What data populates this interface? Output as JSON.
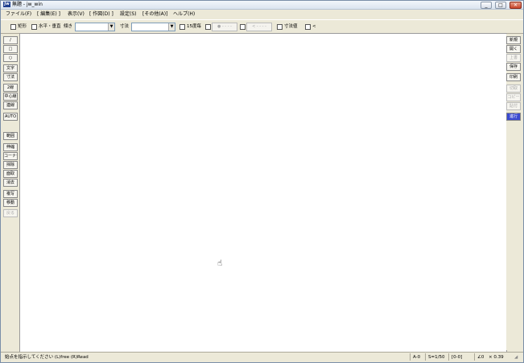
{
  "titlebar": {
    "title": "無題 - jw_win",
    "icon_text": "Jw"
  },
  "menus": [
    "ファイル(F)",
    "[ 編集(E) ]",
    "表示(V)",
    "[ 作図(D) ]",
    "設定(S)",
    "[その他(A)]",
    "ヘルプ(H)"
  ],
  "toolbar": {
    "rect": "矩形",
    "hv": "水平・垂直",
    "angle_label": "傾き",
    "dim_label": "寸法",
    "deg15": "15度毎",
    "disabled1": "● - - - -",
    "disabled2": "< - - - -",
    "dimval": "寸法値",
    "lt": "<"
  },
  "left_tools": {
    "line": "/",
    "rect": "□",
    "circle": "○",
    "text": "文字",
    "dim": "寸法",
    "double": "2線",
    "center": "中心線",
    "cont": "連線",
    "auto": "AUTO",
    "range": "範囲",
    "extend": "伸縮",
    "corner": "コーナー",
    "trim": "掃除",
    "area": "面取",
    "erase": "消去",
    "copy": "複写",
    "move": "移動",
    "undo": "戻る"
  },
  "right_tools": {
    "new": "新規",
    "open": "開く",
    "overwrite": "上書",
    "save": "保存",
    "print": "印刷",
    "cut": "切取",
    "copy": "コピー",
    "paste": "貼付",
    "help": "進行"
  },
  "status": {
    "message": "始点を指示してください (L)free (R)Read",
    "layer": "A-0",
    "scale": "S=1/50",
    "group": "[0-0]",
    "angle": "∠0",
    "zoom": "× 0.39"
  }
}
